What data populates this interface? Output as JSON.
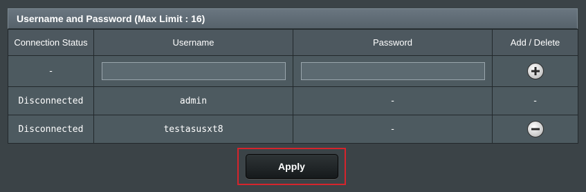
{
  "panel": {
    "title": "Username and Password (Max Limit : 16)"
  },
  "table": {
    "headers": [
      "Connection Status",
      "Username",
      "Password",
      "Add / Delete"
    ],
    "input_row": {
      "status": "-",
      "username_value": "",
      "password_value": "",
      "action_icon": "add-icon"
    },
    "rows": [
      {
        "status": "Disconnected",
        "username": "admin",
        "password": "-",
        "action": "-"
      },
      {
        "status": "Disconnected",
        "username": "testasusxt8",
        "password": "-",
        "action_icon": "remove-icon"
      }
    ]
  },
  "apply": {
    "label": "Apply",
    "highlight_color": "#d6242c"
  }
}
